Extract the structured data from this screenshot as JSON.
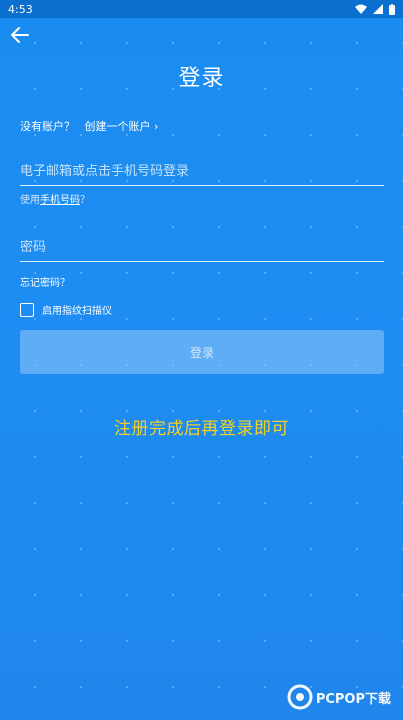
{
  "status": {
    "time": "4:53"
  },
  "header": {
    "title": "登录"
  },
  "signup": {
    "prompt": "没有账户？",
    "link": "创建一个账户"
  },
  "email": {
    "placeholder": "电子邮箱或点击手机号码登录"
  },
  "phone_hint": {
    "prefix": "使用",
    "link": "手机号码",
    "suffix": "？"
  },
  "password": {
    "placeholder": "密码"
  },
  "forgot": {
    "label": "忘记密码？"
  },
  "fingerprint": {
    "label": "启用指纹扫描仪",
    "checked": false
  },
  "login_button": {
    "label": "登录"
  },
  "notice": {
    "text": "注册完成后再登录即可"
  },
  "watermark": {
    "text": "PCPOP下载"
  },
  "colors": {
    "background": "#1e8df2",
    "notice": "#f5d020"
  }
}
